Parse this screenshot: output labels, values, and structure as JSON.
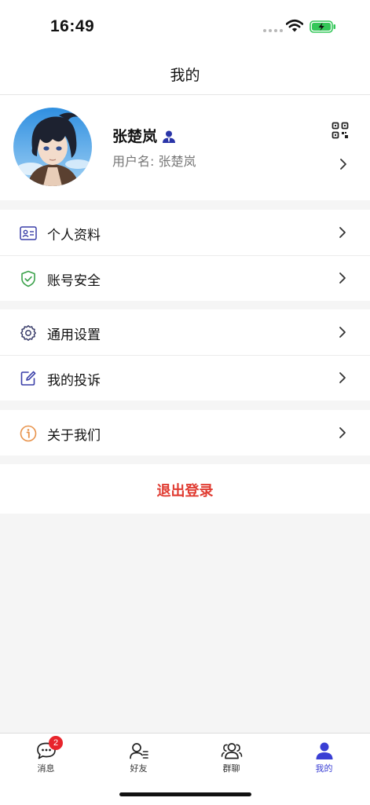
{
  "status_bar": {
    "time": "16:49"
  },
  "nav": {
    "title": "我的"
  },
  "profile": {
    "name": "张楚岚",
    "username_label": "用户名:",
    "username": "张楚岚",
    "username_text": "用户名: 张楚岚"
  },
  "menu_groups": [
    {
      "items": [
        {
          "label": "个人资料",
          "icon": "id-card-icon"
        },
        {
          "label": "账号安全",
          "icon": "shield-check-icon"
        }
      ]
    },
    {
      "items": [
        {
          "label": "通用设置",
          "icon": "gear-icon"
        },
        {
          "label": "我的投诉",
          "icon": "edit-icon"
        }
      ]
    },
    {
      "items": [
        {
          "label": "关于我们",
          "icon": "info-icon"
        }
      ]
    }
  ],
  "logout": {
    "label": "退出登录"
  },
  "tabs": [
    {
      "label": "消息",
      "icon": "chat-bubble-icon",
      "badge": "2",
      "active": false
    },
    {
      "label": "好友",
      "icon": "friends-icon",
      "active": false
    },
    {
      "label": "群聊",
      "icon": "group-icon",
      "active": false
    },
    {
      "label": "我的",
      "icon": "person-icon",
      "active": true
    }
  ],
  "colors": {
    "accent": "#3a3fd4",
    "logout": "#e03c32",
    "badge": "#e8242b",
    "background": "#f5f5f5"
  }
}
